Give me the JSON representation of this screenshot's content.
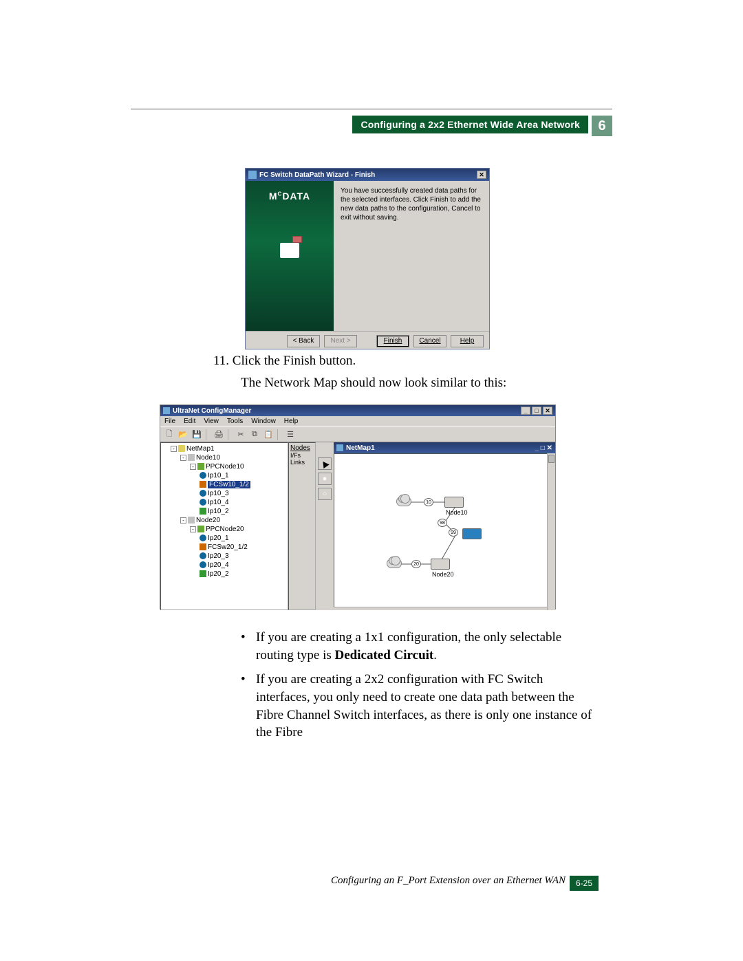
{
  "header": {
    "title": "Configuring a 2x2 Ethernet Wide Area Network",
    "chapter": "6"
  },
  "wizard": {
    "title": "FC Switch DataPath Wizard - Finish",
    "brand_prefix": "M",
    "brand_sup": "C",
    "brand_suffix": "DATA",
    "message": "You have successfully created data paths for the selected interfaces.  Click Finish to add the new data paths to the configuration, Cancel to exit without saving.",
    "buttons": {
      "back": "< Back",
      "next": "Next >",
      "finish": "Finish",
      "cancel": "Cancel",
      "help": "Help"
    }
  },
  "steps": {
    "step_num": "11.",
    "step_text": "Click the Finish button.",
    "result_text": "The Network Map should now look similar to this:"
  },
  "cm": {
    "title": "UltraNet ConfigManager",
    "menu": [
      "File",
      "Edit",
      "View",
      "Tools",
      "Window",
      "Help"
    ],
    "tree": {
      "root": "NetMap1",
      "n1": "Node10",
      "n1p": "PPCNode10",
      "n1i": [
        "Ip10_1",
        "FCSw10_1/2",
        "Ip10_3",
        "Ip10_4",
        "Ip10_2"
      ],
      "n2": "Node20",
      "n2p": "PPCNode20",
      "n2i": [
        "Ip20_1",
        "FCSw20_1/2",
        "Ip20_3",
        "Ip20_4",
        "Ip20_2"
      ]
    },
    "mid": [
      "Nodes",
      "I/Fs",
      "Links"
    ],
    "canvas_title": "NetMap1",
    "labels": {
      "node10": "Node10",
      "node20": "Node20"
    },
    "ports": {
      "p10": "10",
      "p98": "98",
      "p99": "99",
      "p20": "20"
    }
  },
  "bullets": {
    "b1_pre": "If you are creating a 1x1 configuration, the only selectable routing type is ",
    "b1_bold": "Dedicated Circuit",
    "b1_post": ".",
    "b2": "If you are creating a 2x2 configuration with FC Switch interfaces, you only need to create one data path between the Fibre Channel Switch interfaces, as there is only one instance of the Fibre"
  },
  "footer": {
    "text": "Configuring an F_Port Extension over an Ethernet WAN",
    "page": "6-25"
  }
}
